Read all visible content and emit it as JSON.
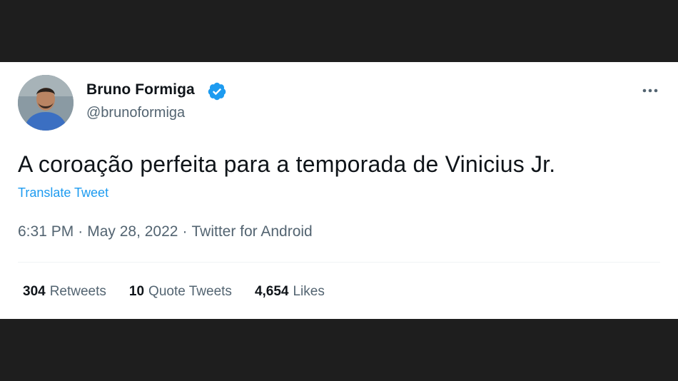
{
  "author": {
    "name": "Bruno Formiga",
    "handle": "@brunoformiga",
    "verified": true
  },
  "tweet": {
    "text": "A coroação perfeita para a temporada de Vinicius Jr.",
    "translate_label": "Translate Tweet"
  },
  "meta": {
    "time": "6:31 PM",
    "separator": "·",
    "date": "May 28, 2022",
    "source": "Twitter for Android"
  },
  "stats": [
    {
      "count": "304",
      "label": "Retweets"
    },
    {
      "count": "10",
      "label": "Quote Tweets"
    },
    {
      "count": "4,654",
      "label": "Likes"
    }
  ],
  "colors": {
    "accent": "#1d9bf0",
    "text_primary": "#0f1419",
    "text_secondary": "#536471",
    "letterbox": "#1e1e1e"
  },
  "icons": {
    "verified": "verified-badge-icon",
    "more": "more-options-icon"
  }
}
